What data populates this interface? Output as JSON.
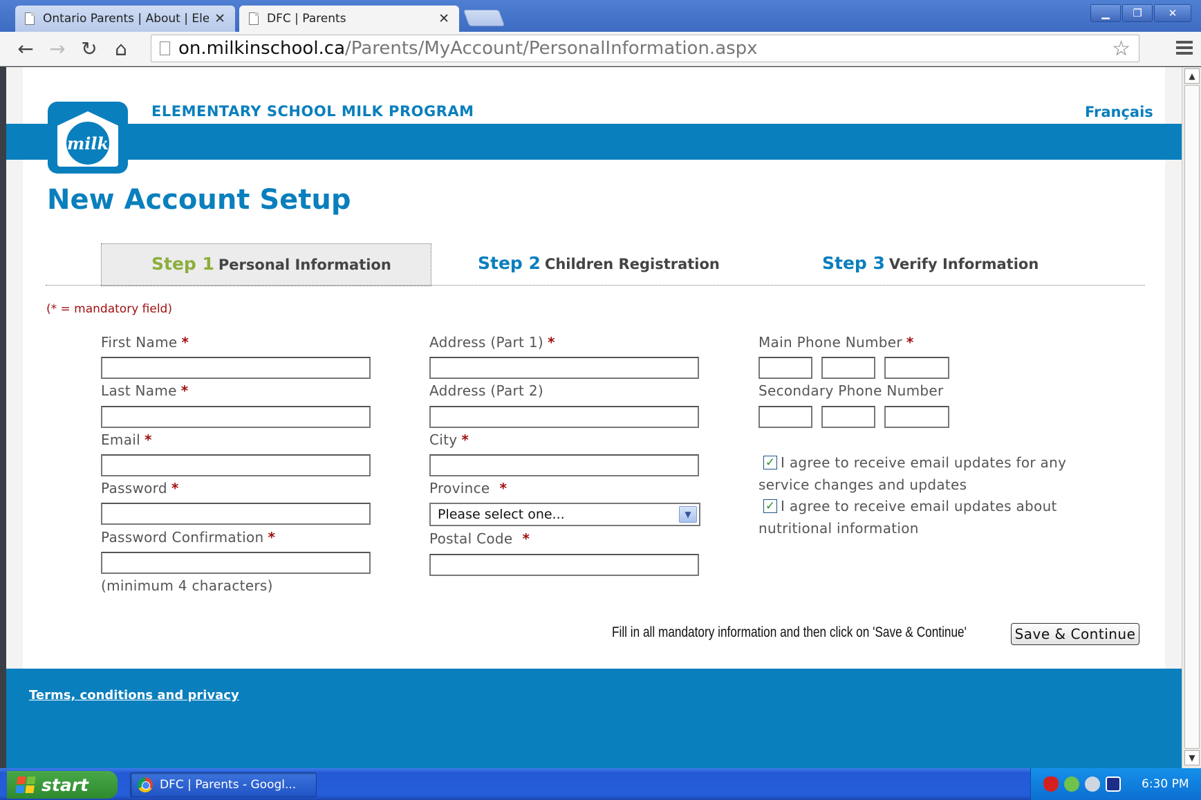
{
  "browser": {
    "tabs": [
      {
        "title": "Ontario Parents | About | Ele",
        "close": "✕"
      },
      {
        "title": "DFC | Parents",
        "close": "✕"
      }
    ],
    "url_host": "on.milkinschool.ca",
    "url_path": "/Parents/MyAccount/PersonalInformation.aspx"
  },
  "header": {
    "program_title": "ELEMENTARY SCHOOL MILK PROGRAM",
    "language_link": "Français",
    "logo_text": "milk"
  },
  "page_title": "New Account Setup",
  "steps": [
    {
      "num": "Step 1",
      "label": "Personal Information"
    },
    {
      "num": "Step 2",
      "label": "Children Registration"
    },
    {
      "num": "Step 3",
      "label": "Verify Information"
    }
  ],
  "mandatory_note": "(* = mandatory field)",
  "form": {
    "first_name": "First Name",
    "last_name": "Last Name",
    "email": "Email",
    "password": "Password",
    "password_confirmation": "Password Confirmation",
    "password_hint": "(minimum 4 characters)",
    "address1": "Address (Part 1)",
    "address2": "Address (Part 2)",
    "city": "City",
    "province": "Province",
    "province_value": "Please select one...",
    "postal_code": "Postal Code",
    "main_phone": "Main Phone Number",
    "secondary_phone": "Secondary Phone Number",
    "agree_service_line1": "I agree to receive email updates for any",
    "agree_service_line2": "service changes and updates",
    "agree_nutrition_line1": "I agree to receive email updates about",
    "agree_nutrition_line2": "nutritional information",
    "required_mark": "*"
  },
  "save_instructions": "Fill in all mandatory information and then click on 'Save & Continue'",
  "save_button": "Save & Continue",
  "footer": {
    "terms_link": "Terms, conditions and privacy"
  },
  "taskbar": {
    "start": "start",
    "task_item": "DFC | Parents - Googl...",
    "clock": "6:30 PM"
  }
}
